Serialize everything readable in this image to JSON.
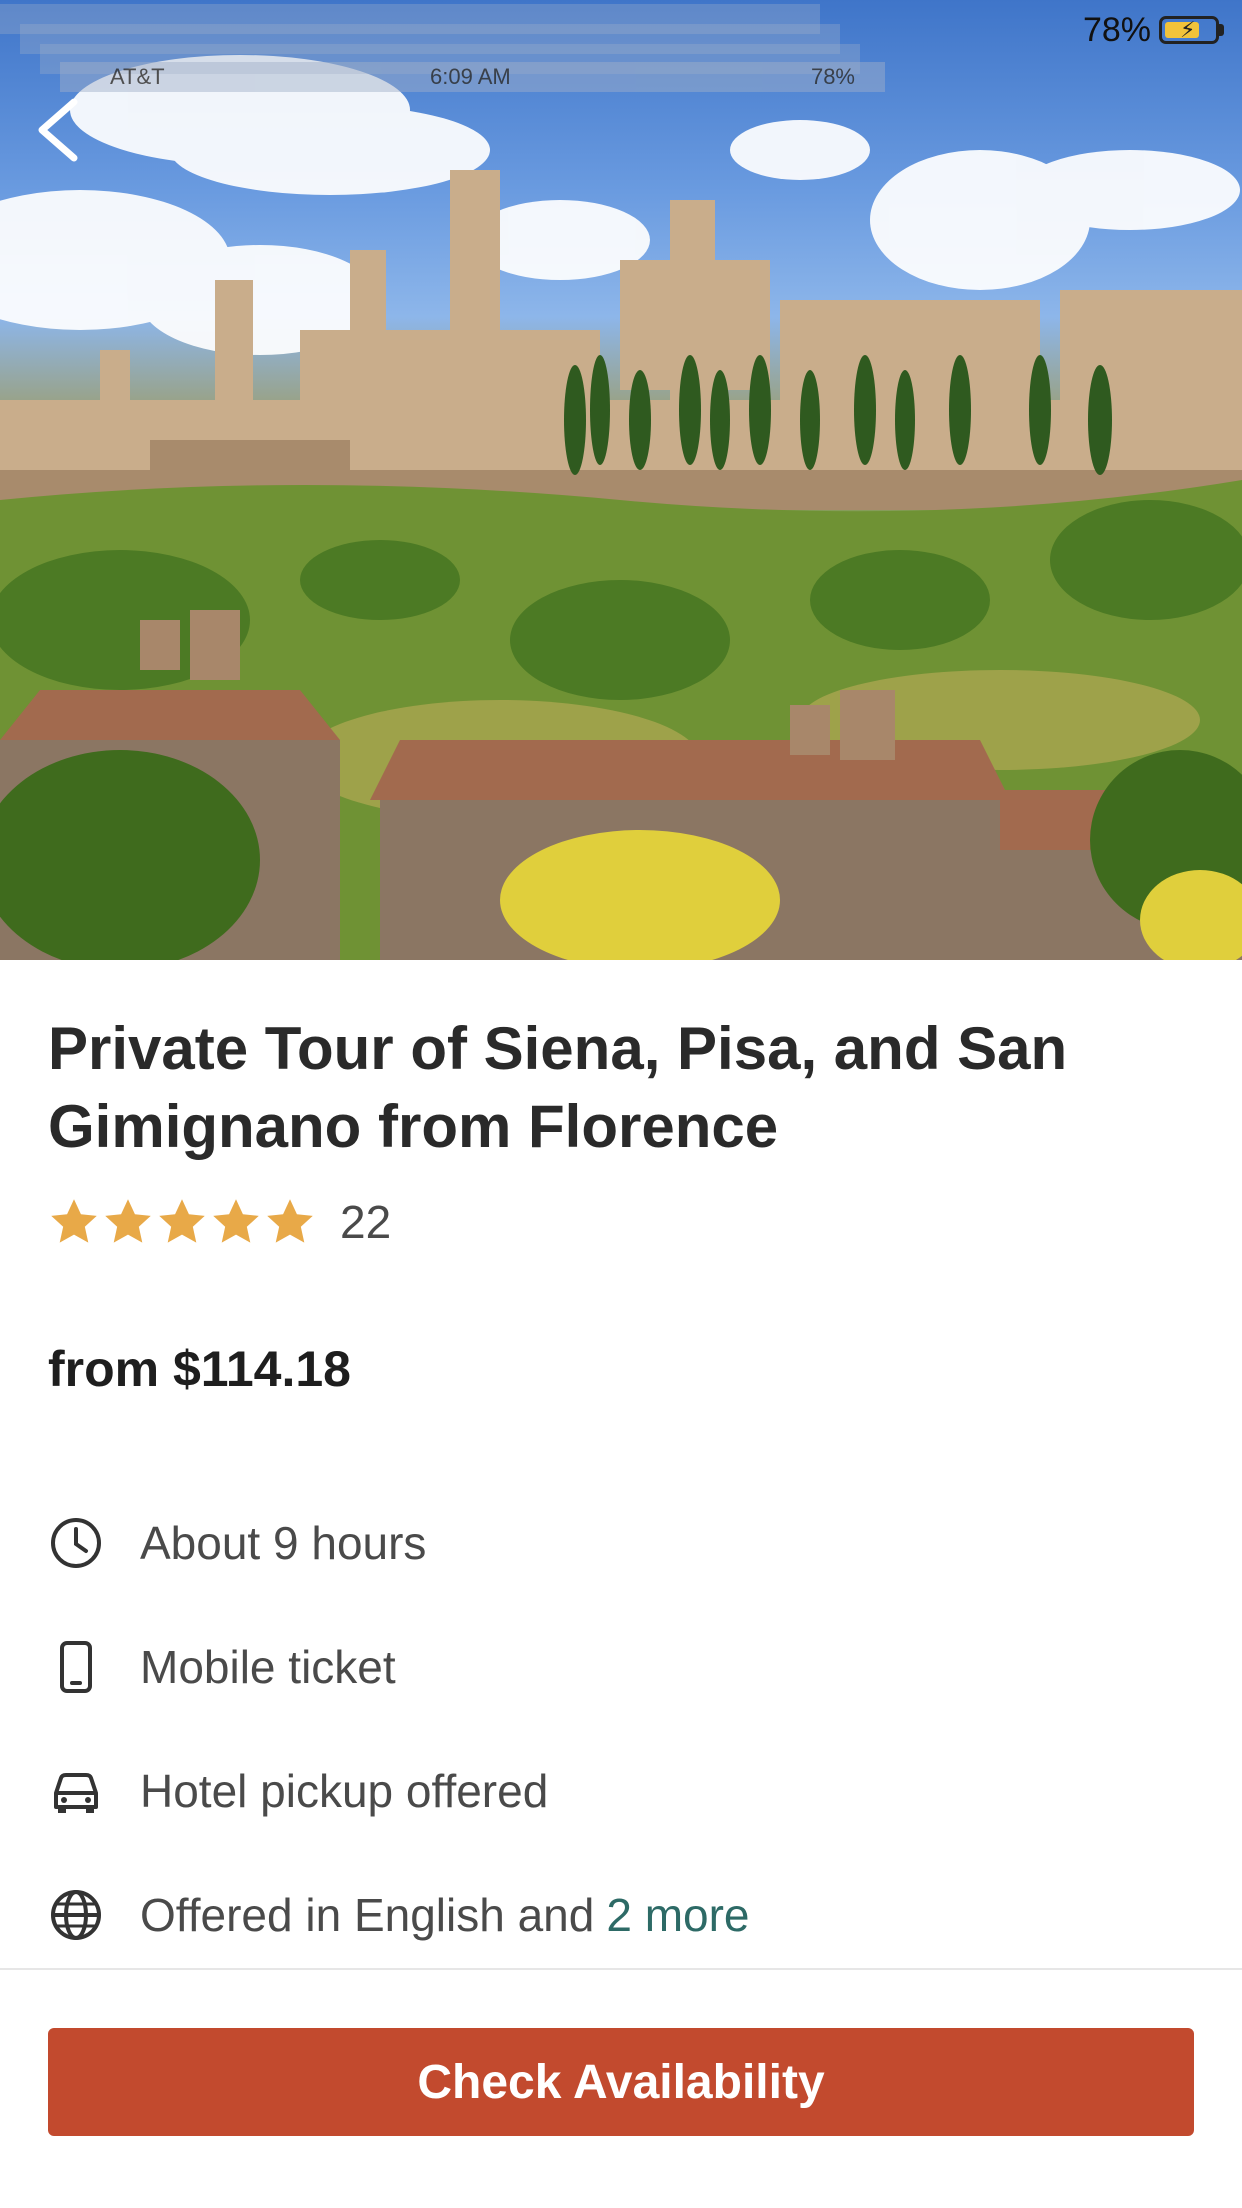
{
  "status_bar": {
    "carrier": "AT&T",
    "time": "6:09 AM",
    "battery": "78%"
  },
  "hero": {
    "image_alt": ""
  },
  "product": {
    "title": "Private Tour of Siena, Pisa, and San Gimignano from Florence",
    "rating_stars": 5,
    "review_count": "22",
    "price": "from $114.18"
  },
  "features": [
    {
      "icon": "clock-icon",
      "text": "About 9 hours"
    },
    {
      "icon": "mobile-phone-icon",
      "text": "Mobile ticket"
    },
    {
      "icon": "car-icon",
      "text": "Hotel pickup offered"
    },
    {
      "icon": "globe-icon",
      "text": "Offered in English and",
      "link": "2 more"
    }
  ],
  "cta": {
    "label": "Check Availability"
  },
  "colors": {
    "accent_cta": "#c24a2e",
    "star": "#e8a948",
    "link": "#2d6a66",
    "text": "#2a2a2a"
  }
}
